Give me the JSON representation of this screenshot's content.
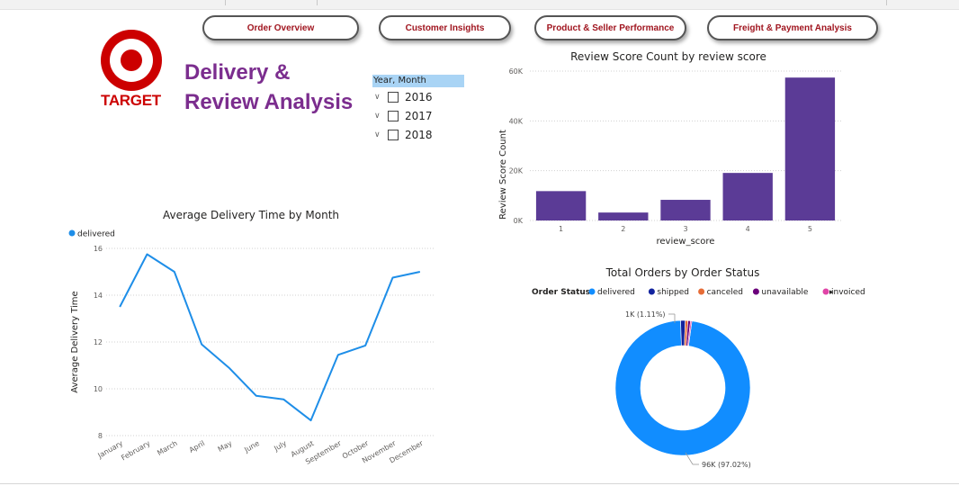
{
  "nav": {
    "buttons": [
      "Order Overview",
      "Customer Insights",
      "Product & Seller Performance",
      "Freight & Payment Analysis"
    ]
  },
  "logo": {
    "text": "TARGET",
    "color": "#cc0000"
  },
  "page": {
    "title_line1": "Delivery &",
    "title_line2": "Review Analysis",
    "title_color": "#7b2d8e"
  },
  "slicer": {
    "header": "Year, Month",
    "items": [
      "2016",
      "2017",
      "2018"
    ]
  },
  "chart_data": [
    {
      "type": "bar",
      "title": "Review Score Count by review score",
      "xlabel": "review_score",
      "ylabel": "Review Score Count",
      "categories": [
        "1",
        "2",
        "3",
        "4",
        "5"
      ],
      "values": [
        11800,
        3200,
        8300,
        19100,
        57400
      ],
      "ylim": [
        0,
        60000
      ],
      "yticks": [
        0,
        20000,
        40000,
        60000
      ],
      "ytick_labels": [
        "0K",
        "20K",
        "40K",
        "60K"
      ],
      "color": "#5b3b96",
      "grid": true
    },
    {
      "type": "line",
      "title": "Average Delivery Time by Month",
      "ylabel": "Average Delivery Time",
      "xlabel": "",
      "legend": [
        "delivered"
      ],
      "legend_position": "top-left",
      "categories": [
        "January",
        "February",
        "March",
        "April",
        "May",
        "June",
        "July",
        "August",
        "September",
        "October",
        "November",
        "December"
      ],
      "series": [
        {
          "name": "delivered",
          "values": [
            13.5,
            15.75,
            15.0,
            11.9,
            10.9,
            9.7,
            9.55,
            8.65,
            11.45,
            11.85,
            14.75,
            15.0
          ]
        }
      ],
      "ylim": [
        8,
        16
      ],
      "yticks": [
        8,
        10,
        12,
        14,
        16
      ],
      "color": "#1e8ee8",
      "grid": true
    },
    {
      "type": "pie",
      "donut": true,
      "title": "Total Orders by Order Status",
      "legend_title": "Order Status",
      "legend_position": "top",
      "categories": [
        "delivered",
        "shipped",
        "canceled",
        "unavailable",
        "invoiced"
      ],
      "values": [
        97.02,
        1.11,
        0.63,
        0.61,
        0.32
      ],
      "colors": [
        "#118dff",
        "#12239e",
        "#e66c37",
        "#6b007b",
        "#e044a7"
      ],
      "labels": [
        {
          "slice": "delivered",
          "text": "96K (97.02%)"
        },
        {
          "slice": "shipped",
          "text": "1K (1.11%)"
        }
      ]
    }
  ]
}
